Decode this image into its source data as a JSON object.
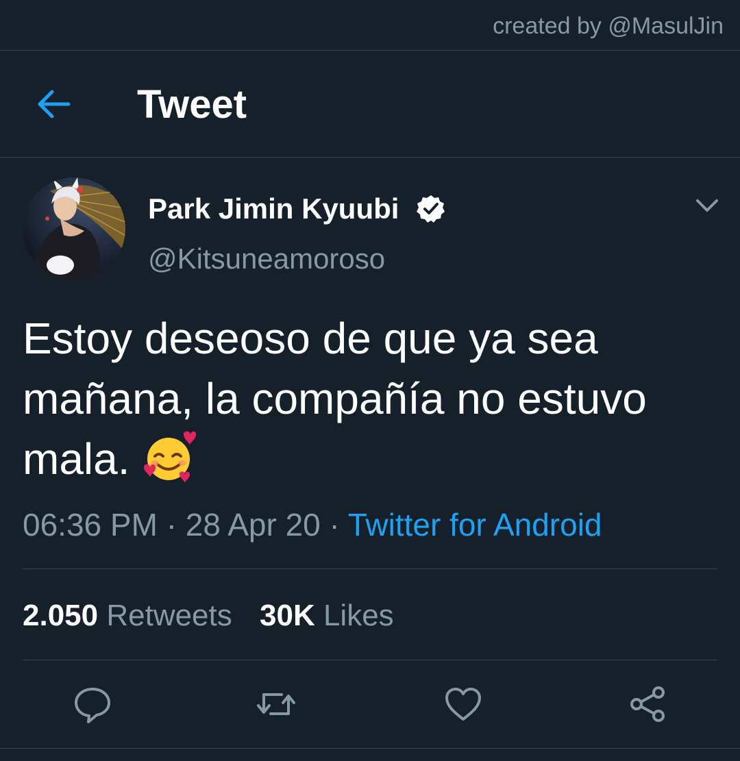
{
  "credit": {
    "text": "created by @MasulJin"
  },
  "header": {
    "title": "Tweet",
    "back_icon": "arrow-left-icon"
  },
  "author": {
    "display_name": "Park Jimin Kyuubi",
    "handle": "@Kitsuneamoroso",
    "verified": true,
    "verified_icon": "verified-badge-icon"
  },
  "tweet": {
    "text": "Estoy deseoso de que ya sea mañana, la compañía no estuvo mala.",
    "emoji": "smiling-face-with-hearts-icon",
    "time": "06:36 PM",
    "separator": "·",
    "date": "28 Apr 20",
    "source": "Twitter for Android"
  },
  "stats": {
    "retweets_count": "2.050",
    "retweets_label": "Retweets",
    "likes_count": "30K",
    "likes_label": "Likes"
  },
  "actions": [
    "reply-icon",
    "retweet-icon",
    "like-icon",
    "share-icon"
  ],
  "colors": {
    "background": "#15202b",
    "divider": "#38444d",
    "secondary_text": "#8899a6",
    "accent": "#1da1f2",
    "primary_text": "#ffffff"
  }
}
